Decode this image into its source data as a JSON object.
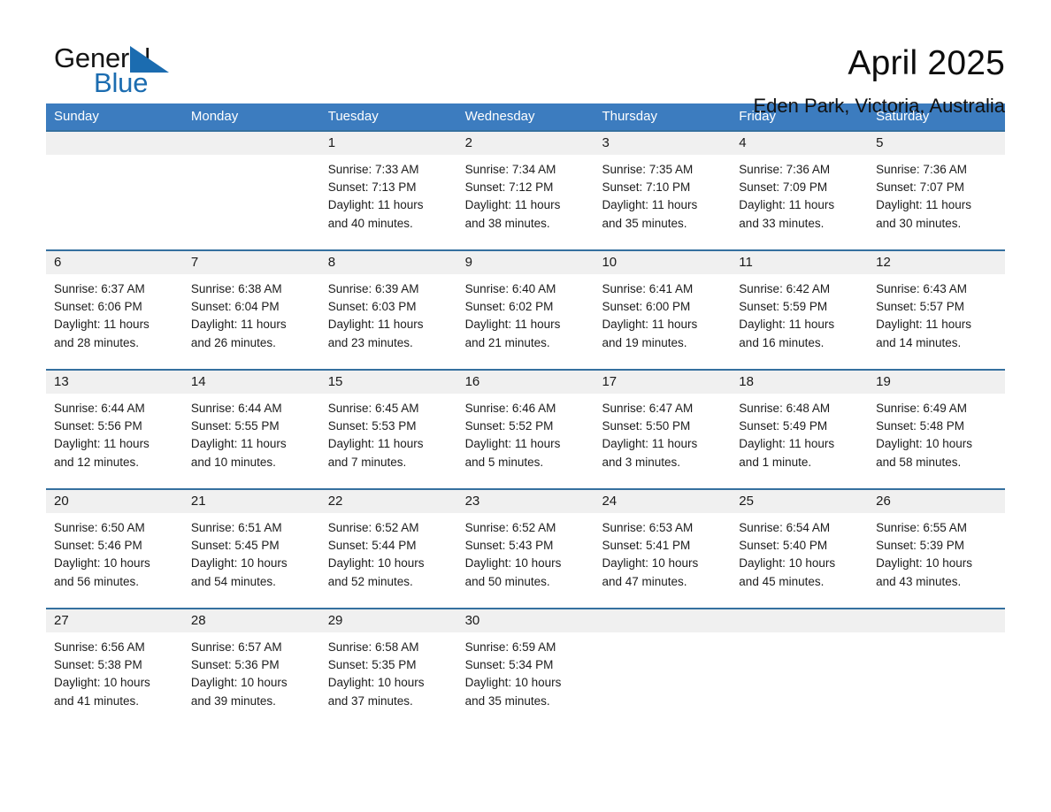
{
  "brand": {
    "name_part1": "General",
    "name_part2": "Blue",
    "triangle_color": "#1b6cb0"
  },
  "header": {
    "month_title": "April 2025",
    "location": "Eden Park, Victoria, Australia"
  },
  "theme": {
    "header_blue": "#3c7cbf",
    "rule_blue": "#35709f",
    "date_band_gray": "#f0f0f0",
    "text_color": "#1a1a1a"
  },
  "calendar": {
    "weekdays": [
      "Sunday",
      "Monday",
      "Tuesday",
      "Wednesday",
      "Thursday",
      "Friday",
      "Saturday"
    ],
    "weeks": [
      {
        "days": [
          {
            "date": "",
            "lines": []
          },
          {
            "date": "",
            "lines": []
          },
          {
            "date": "1",
            "lines": [
              "Sunrise: 7:33 AM",
              "Sunset: 7:13 PM",
              "Daylight: 11 hours",
              "and 40 minutes."
            ]
          },
          {
            "date": "2",
            "lines": [
              "Sunrise: 7:34 AM",
              "Sunset: 7:12 PM",
              "Daylight: 11 hours",
              "and 38 minutes."
            ]
          },
          {
            "date": "3",
            "lines": [
              "Sunrise: 7:35 AM",
              "Sunset: 7:10 PM",
              "Daylight: 11 hours",
              "and 35 minutes."
            ]
          },
          {
            "date": "4",
            "lines": [
              "Sunrise: 7:36 AM",
              "Sunset: 7:09 PM",
              "Daylight: 11 hours",
              "and 33 minutes."
            ]
          },
          {
            "date": "5",
            "lines": [
              "Sunrise: 7:36 AM",
              "Sunset: 7:07 PM",
              "Daylight: 11 hours",
              "and 30 minutes."
            ]
          }
        ]
      },
      {
        "days": [
          {
            "date": "6",
            "lines": [
              "Sunrise: 6:37 AM",
              "Sunset: 6:06 PM",
              "Daylight: 11 hours",
              "and 28 minutes."
            ]
          },
          {
            "date": "7",
            "lines": [
              "Sunrise: 6:38 AM",
              "Sunset: 6:04 PM",
              "Daylight: 11 hours",
              "and 26 minutes."
            ]
          },
          {
            "date": "8",
            "lines": [
              "Sunrise: 6:39 AM",
              "Sunset: 6:03 PM",
              "Daylight: 11 hours",
              "and 23 minutes."
            ]
          },
          {
            "date": "9",
            "lines": [
              "Sunrise: 6:40 AM",
              "Sunset: 6:02 PM",
              "Daylight: 11 hours",
              "and 21 minutes."
            ]
          },
          {
            "date": "10",
            "lines": [
              "Sunrise: 6:41 AM",
              "Sunset: 6:00 PM",
              "Daylight: 11 hours",
              "and 19 minutes."
            ]
          },
          {
            "date": "11",
            "lines": [
              "Sunrise: 6:42 AM",
              "Sunset: 5:59 PM",
              "Daylight: 11 hours",
              "and 16 minutes."
            ]
          },
          {
            "date": "12",
            "lines": [
              "Sunrise: 6:43 AM",
              "Sunset: 5:57 PM",
              "Daylight: 11 hours",
              "and 14 minutes."
            ]
          }
        ]
      },
      {
        "days": [
          {
            "date": "13",
            "lines": [
              "Sunrise: 6:44 AM",
              "Sunset: 5:56 PM",
              "Daylight: 11 hours",
              "and 12 minutes."
            ]
          },
          {
            "date": "14",
            "lines": [
              "Sunrise: 6:44 AM",
              "Sunset: 5:55 PM",
              "Daylight: 11 hours",
              "and 10 minutes."
            ]
          },
          {
            "date": "15",
            "lines": [
              "Sunrise: 6:45 AM",
              "Sunset: 5:53 PM",
              "Daylight: 11 hours",
              "and 7 minutes."
            ]
          },
          {
            "date": "16",
            "lines": [
              "Sunrise: 6:46 AM",
              "Sunset: 5:52 PM",
              "Daylight: 11 hours",
              "and 5 minutes."
            ]
          },
          {
            "date": "17",
            "lines": [
              "Sunrise: 6:47 AM",
              "Sunset: 5:50 PM",
              "Daylight: 11 hours",
              "and 3 minutes."
            ]
          },
          {
            "date": "18",
            "lines": [
              "Sunrise: 6:48 AM",
              "Sunset: 5:49 PM",
              "Daylight: 11 hours",
              "and 1 minute."
            ]
          },
          {
            "date": "19",
            "lines": [
              "Sunrise: 6:49 AM",
              "Sunset: 5:48 PM",
              "Daylight: 10 hours",
              "and 58 minutes."
            ]
          }
        ]
      },
      {
        "days": [
          {
            "date": "20",
            "lines": [
              "Sunrise: 6:50 AM",
              "Sunset: 5:46 PM",
              "Daylight: 10 hours",
              "and 56 minutes."
            ]
          },
          {
            "date": "21",
            "lines": [
              "Sunrise: 6:51 AM",
              "Sunset: 5:45 PM",
              "Daylight: 10 hours",
              "and 54 minutes."
            ]
          },
          {
            "date": "22",
            "lines": [
              "Sunrise: 6:52 AM",
              "Sunset: 5:44 PM",
              "Daylight: 10 hours",
              "and 52 minutes."
            ]
          },
          {
            "date": "23",
            "lines": [
              "Sunrise: 6:52 AM",
              "Sunset: 5:43 PM",
              "Daylight: 10 hours",
              "and 50 minutes."
            ]
          },
          {
            "date": "24",
            "lines": [
              "Sunrise: 6:53 AM",
              "Sunset: 5:41 PM",
              "Daylight: 10 hours",
              "and 47 minutes."
            ]
          },
          {
            "date": "25",
            "lines": [
              "Sunrise: 6:54 AM",
              "Sunset: 5:40 PM",
              "Daylight: 10 hours",
              "and 45 minutes."
            ]
          },
          {
            "date": "26",
            "lines": [
              "Sunrise: 6:55 AM",
              "Sunset: 5:39 PM",
              "Daylight: 10 hours",
              "and 43 minutes."
            ]
          }
        ]
      },
      {
        "days": [
          {
            "date": "27",
            "lines": [
              "Sunrise: 6:56 AM",
              "Sunset: 5:38 PM",
              "Daylight: 10 hours",
              "and 41 minutes."
            ]
          },
          {
            "date": "28",
            "lines": [
              "Sunrise: 6:57 AM",
              "Sunset: 5:36 PM",
              "Daylight: 10 hours",
              "and 39 minutes."
            ]
          },
          {
            "date": "29",
            "lines": [
              "Sunrise: 6:58 AM",
              "Sunset: 5:35 PM",
              "Daylight: 10 hours",
              "and 37 minutes."
            ]
          },
          {
            "date": "30",
            "lines": [
              "Sunrise: 6:59 AM",
              "Sunset: 5:34 PM",
              "Daylight: 10 hours",
              "and 35 minutes."
            ]
          },
          {
            "date": "",
            "lines": []
          },
          {
            "date": "",
            "lines": []
          },
          {
            "date": "",
            "lines": []
          }
        ]
      }
    ]
  }
}
